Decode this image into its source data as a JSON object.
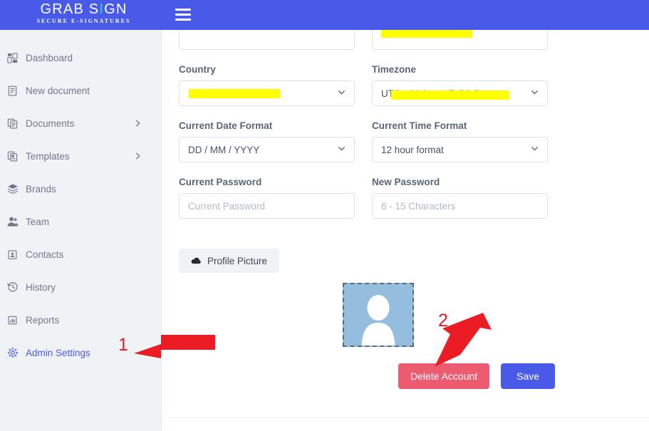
{
  "brand": {
    "logo_main_pre": "GRAB S",
    "logo_main_i": "I",
    "logo_main_post": "GN",
    "logo_sub": "SECURE E-SIGNATURES",
    "primary_color": "#4a5ae8",
    "accent_color": "#35d3c9",
    "danger_color": "#ec5b70",
    "sidebar_bg": "#eff3f6",
    "redaction_color": "#ffff00",
    "annotation_color": "#e8192c"
  },
  "header": {
    "menu_icon": "hamburger-menu-icon"
  },
  "sidebar": {
    "items": [
      {
        "label": "Dashboard",
        "icon": "dashboard-grid-icon",
        "has_chevron": false,
        "active": false
      },
      {
        "label": "New document",
        "icon": "document-icon",
        "has_chevron": false,
        "active": false
      },
      {
        "label": "Documents",
        "icon": "documents-stack-icon",
        "has_chevron": true,
        "active": false
      },
      {
        "label": "Templates",
        "icon": "templates-icon",
        "has_chevron": true,
        "active": false
      },
      {
        "label": "Brands",
        "icon": "layers-icon",
        "has_chevron": false,
        "active": false
      },
      {
        "label": "Team",
        "icon": "people-icon",
        "has_chevron": false,
        "active": false
      },
      {
        "label": "Contacts",
        "icon": "contact-card-icon",
        "has_chevron": false,
        "active": false
      },
      {
        "label": "History",
        "icon": "clock-history-icon",
        "has_chevron": false,
        "active": false
      },
      {
        "label": "Reports",
        "icon": "bar-chart-icon",
        "has_chevron": false,
        "active": false
      },
      {
        "label": "Admin Settings",
        "icon": "gear-icon",
        "has_chevron": false,
        "active": true
      }
    ]
  },
  "form": {
    "field_top_left": {
      "label": "",
      "value": "",
      "redacted": false
    },
    "field_top_right": {
      "label": "",
      "value": "",
      "redacted": true
    },
    "country": {
      "label": "Country",
      "value": "",
      "redacted": true,
      "caret_icon": "chevron-down-icon"
    },
    "timezone": {
      "label": "Timezone",
      "value": "UTC +11 Australia/Melbourne",
      "redacted": true,
      "caret_icon": "chevron-down-icon"
    },
    "date_format": {
      "label": "Current Date Format",
      "value": "DD / MM / YYYY",
      "redacted": false,
      "caret_icon": "chevron-down-icon"
    },
    "time_format": {
      "label": "Current Time Format",
      "value": "12 hour format",
      "redacted": false,
      "caret_icon": "chevron-down-icon"
    },
    "current_password": {
      "label": "Current Password",
      "value": "",
      "placeholder": "Current Password"
    },
    "new_password": {
      "label": "New Password",
      "value": "",
      "placeholder": "6 - 15 Characters"
    },
    "profile_picture_button": {
      "label": "Profile Picture",
      "icon": "cloud-upload-icon"
    },
    "avatar": {
      "icon": "default-user-avatar-icon"
    }
  },
  "actions": {
    "delete_label": "Delete Account",
    "save_label": "Save"
  },
  "annotations": [
    {
      "number": "1",
      "points_to": "profile-picture-avatar",
      "direction": "left"
    },
    {
      "number": "2",
      "points_to": "delete-account-button",
      "direction": "down-left"
    }
  ]
}
